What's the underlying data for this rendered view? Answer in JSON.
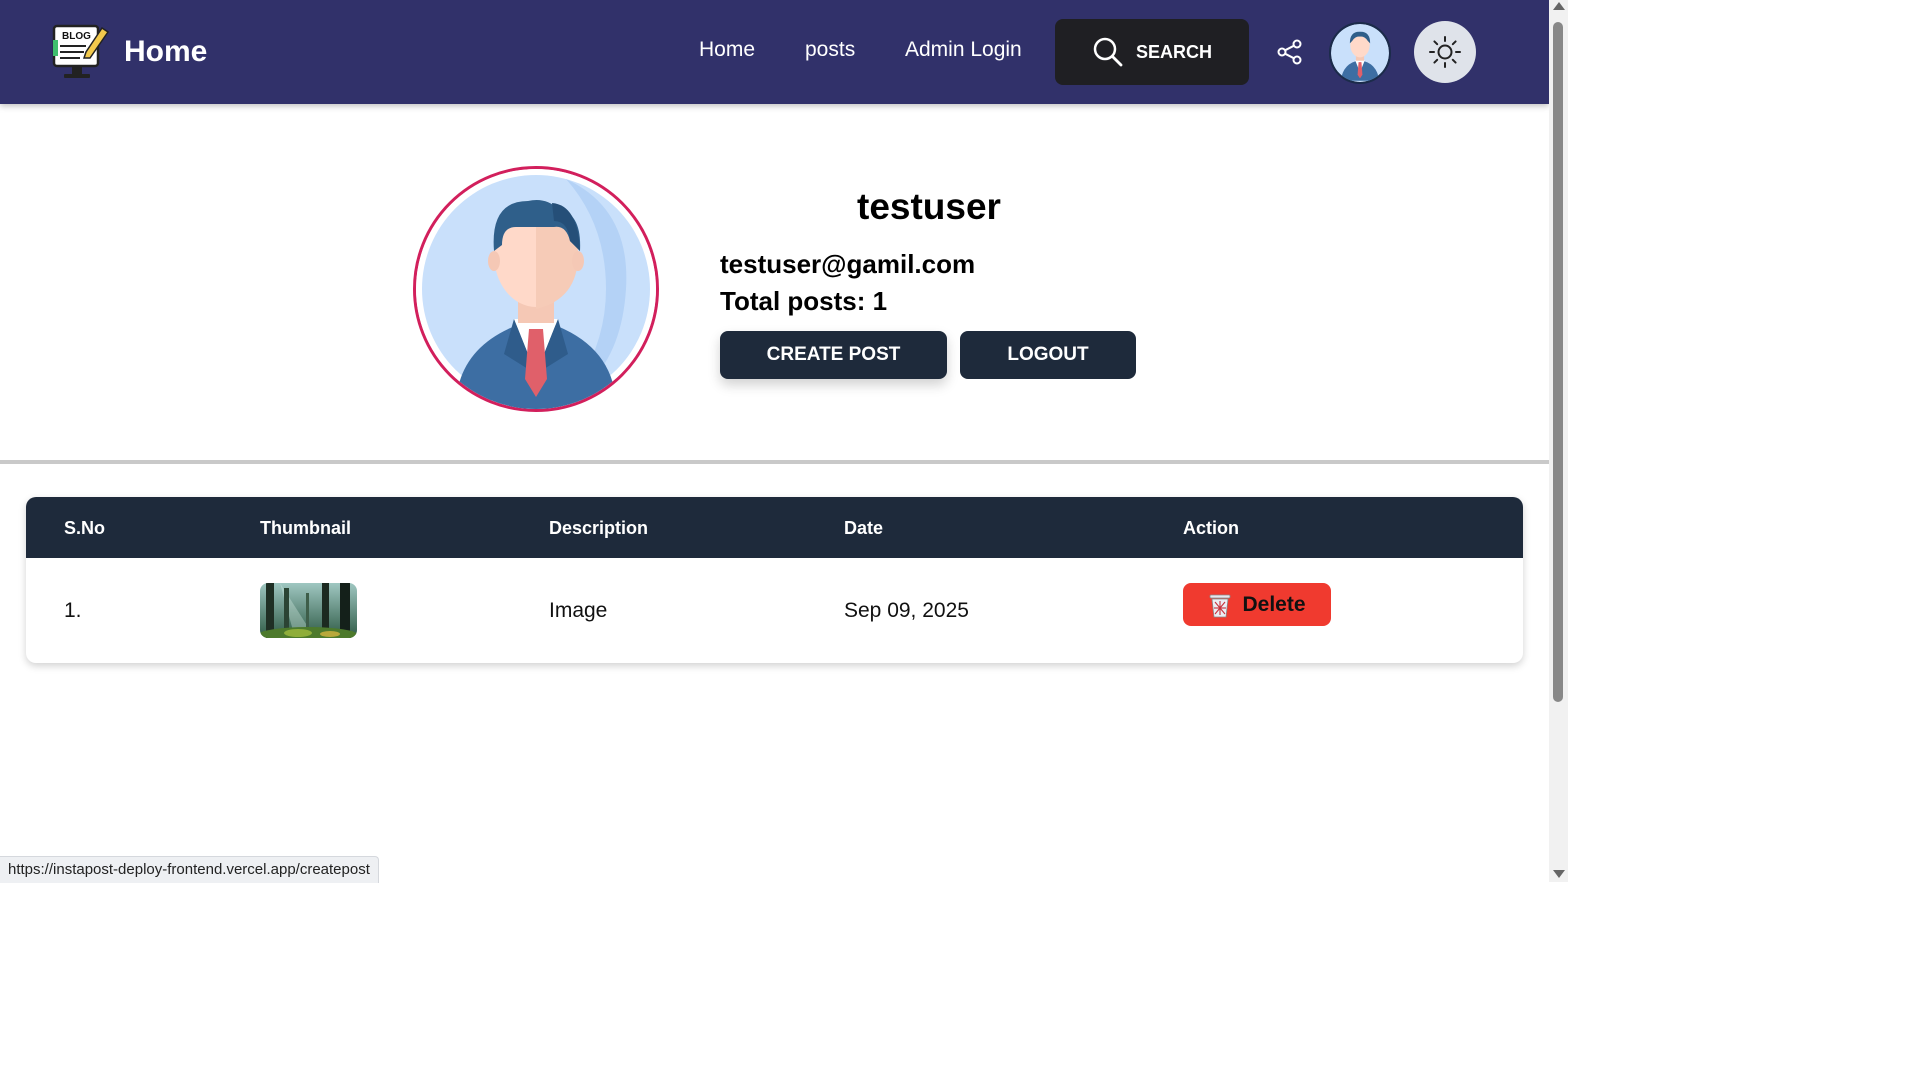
{
  "navbar": {
    "brand": "Home",
    "logo_icon": "blog-monitor-icon",
    "links": [
      "Home",
      "posts",
      "Admin Login"
    ],
    "search_label": "SEARCH",
    "colors": {
      "background": "#31316a",
      "search_bg": "#1f1f23"
    }
  },
  "profile": {
    "username": "testuser",
    "email": "testuser@gamil.com",
    "total_posts": "Total posts: 1",
    "create_label": "CREATE POST",
    "logout_label": "LOGOUT",
    "avatar_border_color": "#d21f5c"
  },
  "table": {
    "headers": [
      "S.No",
      "Thumbnail",
      "Description",
      "Date",
      "Action"
    ],
    "rows": [
      {
        "sno": "1.",
        "thumbnail": "forest-image",
        "description": "Image",
        "date": "Sep 09, 2025",
        "action": "Delete"
      }
    ],
    "colors": {
      "header_bg": "#1e2a3b",
      "delete_bg": "#f03a2f"
    }
  },
  "status_bar": {
    "url": "https://instapost-deploy-frontend.vercel.app/createpost"
  }
}
